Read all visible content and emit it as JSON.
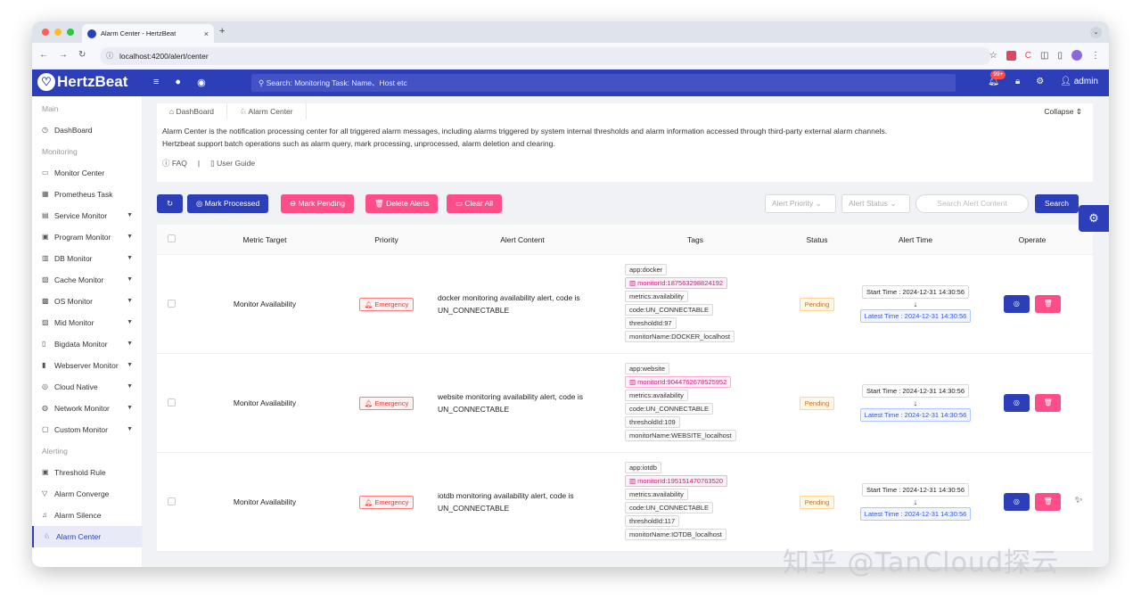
{
  "browser": {
    "tab_title": "Alarm Center - HertzBeat",
    "tab_close": "×",
    "new_tab": "+",
    "url": "localhost:4200/alert/center"
  },
  "header": {
    "logo_text": "HertzBeat",
    "search_placeholder": "Search: Monitoring Task: Name、Host etc",
    "notif_count": "99+",
    "user": "admin"
  },
  "sidebar": {
    "groups": {
      "main": "Main",
      "monitoring": "Monitoring",
      "alerting": "Alerting"
    },
    "items": [
      {
        "label": "DashBoard",
        "icon": "dashboard-icon",
        "glyph": "◷"
      },
      {
        "label": "Monitor Center",
        "icon": "monitor-icon",
        "glyph": "▭"
      },
      {
        "label": "Prometheus Task",
        "icon": "task-icon",
        "glyph": "▦"
      },
      {
        "label": "Service Monitor",
        "icon": "service-icon",
        "glyph": "▤"
      },
      {
        "label": "Program Monitor",
        "icon": "program-icon",
        "glyph": "▣"
      },
      {
        "label": "DB Monitor",
        "icon": "db-icon",
        "glyph": "▥"
      },
      {
        "label": "Cache Monitor",
        "icon": "cache-icon",
        "glyph": "▧"
      },
      {
        "label": "OS Monitor",
        "icon": "os-icon",
        "glyph": "▩"
      },
      {
        "label": "Mid Monitor",
        "icon": "mid-icon",
        "glyph": "▨"
      },
      {
        "label": "Bigdata Monitor",
        "icon": "bigdata-icon",
        "glyph": "▯"
      },
      {
        "label": "Webserver Monitor",
        "icon": "webserver-icon",
        "glyph": "▮"
      },
      {
        "label": "Cloud Native",
        "icon": "cloud-icon",
        "glyph": "◎"
      },
      {
        "label": "Network Monitor",
        "icon": "network-icon",
        "glyph": "◍"
      },
      {
        "label": "Custom Monitor",
        "icon": "custom-icon",
        "glyph": "▢"
      },
      {
        "label": "Threshold Rule",
        "icon": "threshold-icon",
        "glyph": "▣"
      },
      {
        "label": "Alarm Converge",
        "icon": "converge-icon",
        "glyph": "▽"
      },
      {
        "label": "Alarm Silence",
        "icon": "silence-icon",
        "glyph": "♫"
      },
      {
        "label": "Alarm Center",
        "icon": "alarm-icon",
        "glyph": "♘"
      }
    ]
  },
  "breadcrumb": {
    "home": "DashBoard",
    "current": "Alarm Center",
    "collapse": "Collapse"
  },
  "intro": {
    "line1": "Alarm Center is the notification processing center for all triggered alarm messages, including alarms triggered by system internal thresholds and alarm information accessed through third-party external alarm channels.",
    "line2": "Hertzbeat support batch operations such as alarm query, mark processing, unprocessed, alarm deletion and clearing.",
    "faq": "FAQ",
    "sep": "|",
    "guide": "User Guide"
  },
  "toolbar": {
    "mark_processed": "Mark Processed",
    "mark_pending": "Mark Pending",
    "delete_alerts": "Delete Alerts",
    "clear_all": "Clear All",
    "priority_placeholder": "Alert Priority",
    "status_placeholder": "Alert Status",
    "search_placeholder": "Search Alert Content",
    "search_button": "Search"
  },
  "table": {
    "headers": [
      "Metric Target",
      "Priority",
      "Alert Content",
      "Tags",
      "Status",
      "Alert Time",
      "Operate"
    ],
    "rows": [
      {
        "target": "Monitor Availability",
        "priority": "Emergency",
        "content": "docker monitoring availability alert, code is UN_CONNECTABLE",
        "tags": [
          "app:docker",
          "monitorId:187563298824192",
          "metrics:availability",
          "code:UN_CONNECTABLE",
          "thresholdId:97",
          "monitorName:DOCKER_localhost"
        ],
        "status": "Pending",
        "start": "Start Time : 2024-12-31 14:30:56",
        "latest": "Latest Time : 2024-12-31 14:30:56"
      },
      {
        "target": "Monitor Availability",
        "priority": "Emergency",
        "content": "website monitoring availability alert, code is UN_CONNECTABLE",
        "tags": [
          "app:website",
          "monitorId:9044762678525952",
          "metrics:availability",
          "code:UN_CONNECTABLE",
          "thresholdId:109",
          "monitorName:WEBSITE_localhost"
        ],
        "status": "Pending",
        "start": "Start Time : 2024-12-31 14:30:56",
        "latest": "Latest Time : 2024-12-31 14:30:56"
      },
      {
        "target": "Monitor Availability",
        "priority": "Emergency",
        "content": "iotdb monitoring availability alert, code is UN_CONNECTABLE",
        "tags": [
          "app:iotdb",
          "monitorId:195151470763520",
          "metrics:availability",
          "code:UN_CONNECTABLE",
          "thresholdId:117",
          "monitorName:IOTDB_localhost"
        ],
        "status": "Pending",
        "start": "Start Time : 2024-12-31 14:30:56",
        "latest": "Latest Time : 2024-12-31 14:30:56"
      }
    ]
  },
  "watermark": "知乎 @TanCloud探云",
  "colors": {
    "primary": "#2d3fb8",
    "pink": "#ff4d8a"
  }
}
